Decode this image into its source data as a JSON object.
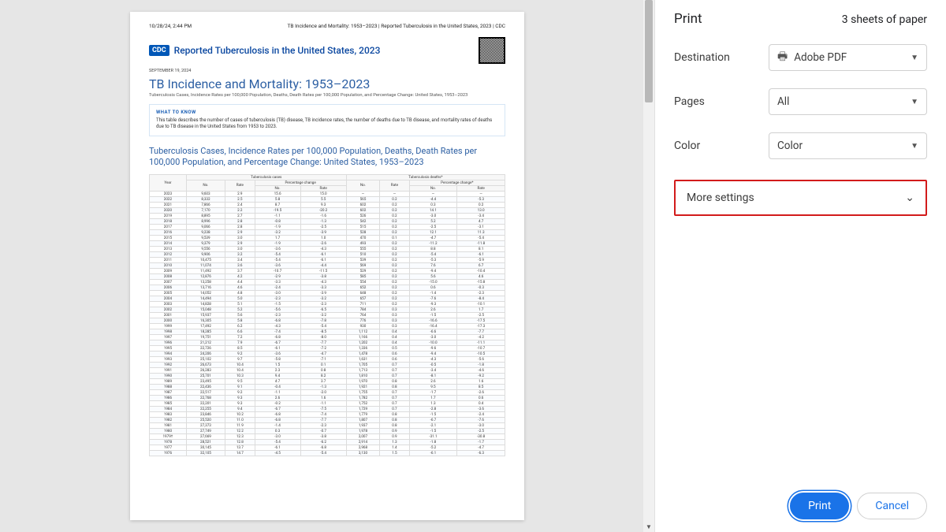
{
  "panel": {
    "title": "Print",
    "sheet_count": "3 sheets of paper",
    "destination_label": "Destination",
    "destination_value": "Adobe PDF",
    "pages_label": "Pages",
    "pages_value": "All",
    "color_label": "Color",
    "color_value": "Color",
    "more_label": "More settings",
    "print_btn": "Print",
    "cancel_btn": "Cancel"
  },
  "doc": {
    "timestamp": "10/28/24, 2:44 PM",
    "header_title": "TB Incidence and Mortality: 1953–2023 | Reported Tuberculosis in the United States, 2023 | CDC",
    "cdc_badge": "CDC",
    "brand_title": "Reported Tuberculosis in the United States, 2023",
    "pub_date": "SEPTEMBER 19, 2024",
    "title": "TB Incidence and Mortality: 1953–2023",
    "subtitle": "Tuberculosis Cases, Incidence Rates per 100,000 Population, Deaths, Death Rates per 100,000 Population, and Percentage Change: United States, 1953–2023",
    "what_label": "WHAT TO KNOW",
    "what_text": "This table describes the number of cases of tuberculosis (TB) disease, TB incidence rates, the number of deaths due to TB disease, and mortality rates of deaths due to TB disease in the United States from 1953 to 2023.",
    "section_title": "Tuberculosis Cases, Incidence Rates per 100,000 Population, Deaths, Death Rates per 100,000 Population, and Percentage Change: United States, 1953–2023",
    "th_group_cases": "Tuberculosis cases",
    "th_group_deaths": "Tuberculosis deaths*",
    "th_pct": "Percentage change",
    "th_pct2": "Percentage change*",
    "th_year": "Year",
    "th_no": "No.",
    "th_rate": "Rate"
  },
  "rows": [
    [
      "2023",
      "9,603",
      "2.9",
      "15.6",
      "15.0",
      "—",
      "—",
      "—",
      "—"
    ],
    [
      "2022",
      "8,332",
      "2.5",
      "5.8",
      "5.5",
      "565",
      "0.2",
      "-4.4",
      "-5.3"
    ],
    [
      "2021",
      "7,866",
      "2.4",
      "8.7",
      "9.3",
      "602",
      "0.2",
      "0.3",
      "0.2"
    ],
    [
      "2020",
      "7,170",
      "2.2",
      "-19.5",
      "-20.2",
      "602",
      "0.2",
      "14.1",
      "13.0"
    ],
    [
      "2019",
      "8,895",
      "2.7",
      "-1.1",
      "-1.6",
      "526",
      "0.2",
      "-3.0",
      "-3.4"
    ],
    [
      "2018",
      "8,996",
      "2.8",
      "-0.8",
      "-1.3",
      "542",
      "0.2",
      "5.2",
      "4.7"
    ],
    [
      "2017",
      "9,066",
      "2.8",
      "-1.9",
      "-2.5",
      "515",
      "0.2",
      "-2.5",
      "-3.1"
    ],
    [
      "2016",
      "9,238",
      "2.9",
      "-3.2",
      "-3.9",
      "528",
      "0.2",
      "12.1",
      "11.3"
    ],
    [
      "2015",
      "9,539",
      "3.0",
      "1.7",
      "1.0",
      "470",
      "0.1",
      "-4.7",
      "-5.4"
    ],
    [
      "2014",
      "9,379",
      "2.9",
      "-1.9",
      "-2.6",
      "493",
      "0.2",
      "-11.2",
      "-11.8"
    ],
    [
      "2013",
      "9,556",
      "3.0",
      "-3.6",
      "-4.3",
      "555",
      "0.2",
      "8.8",
      "8.1"
    ],
    [
      "2012",
      "9,906",
      "3.2",
      "-5.4",
      "-6.1",
      "510",
      "0.2",
      "-5.4",
      "-6.1"
    ],
    [
      "2011",
      "10,475",
      "3.4",
      "-5.4",
      "-6.1",
      "539",
      "0.2",
      "-5.3",
      "-5.9"
    ],
    [
      "2010",
      "11,074",
      "3.6",
      "-3.6",
      "-4.4",
      "569",
      "0.2",
      "7.6",
      "6.7"
    ],
    [
      "2009",
      "11,492",
      "3.7",
      "-10.7",
      "-11.5",
      "529",
      "0.2",
      "-9.4",
      "-10.4"
    ],
    [
      "2008",
      "12,876",
      "4.2",
      "-2.9",
      "-3.8",
      "585",
      "0.2",
      "5.6",
      "4.6"
    ],
    [
      "2007",
      "13,258",
      "4.4",
      "-3.3",
      "-4.3",
      "554",
      "0.2",
      "-15.0",
      "-15.8"
    ],
    [
      "2006",
      "13,716",
      "4.6",
      "-2.4",
      "-3.3",
      "652",
      "0.2",
      "0.6",
      "-0.3"
    ],
    [
      "2005",
      "14,052",
      "4.8",
      "-3.0",
      "-3.9",
      "648",
      "0.2",
      "-1.4",
      "-2.3"
    ],
    [
      "2004",
      "14,494",
      "5.0",
      "-2.3",
      "-3.2",
      "657",
      "0.2",
      "-7.6",
      "-8.4"
    ],
    [
      "2003",
      "14,828",
      "5.1",
      "-1.5",
      "-2.3",
      "711",
      "0.2",
      "-9.3",
      "-10.1"
    ],
    [
      "2002",
      "15,048",
      "5.2",
      "-5.6",
      "-6.5",
      "784",
      "0.3",
      "2.6",
      "1.7"
    ],
    [
      "2001",
      "15,937",
      "5.6",
      "-2.3",
      "-3.2",
      "764",
      "0.3",
      "-1.5",
      "-2.5"
    ],
    [
      "2000",
      "16,305",
      "5.8",
      "-6.8",
      "-7.8",
      "776",
      "0.3",
      "-16.6",
      "-17.5"
    ],
    [
      "1999",
      "17,492",
      "6.2",
      "-4.3",
      "-5.4",
      "930",
      "0.3",
      "-16.4",
      "-17.3"
    ],
    [
      "1998",
      "18,285",
      "6.6",
      "-7.4",
      "-8.5",
      "1,112",
      "0.4",
      "-6.6",
      "-7.7"
    ],
    [
      "1997",
      "19,751",
      "7.2",
      "-6.8",
      "-8.0",
      "1,166",
      "0.4",
      "-3.0",
      "-4.2"
    ],
    [
      "1996",
      "21,212",
      "7.9",
      "-6.7",
      "-7.7",
      "1,202",
      "0.4",
      "-10.0",
      "-11.1"
    ],
    [
      "1995",
      "22,726",
      "8.5",
      "-6.1",
      "-7.2",
      "1,336",
      "0.5",
      "-9.6",
      "-10.7"
    ],
    [
      "1994",
      "24,206",
      "9.2",
      "-3.6",
      "-4.7",
      "1,478",
      "0.6",
      "-9.4",
      "-10.5"
    ],
    [
      "1993",
      "25,102",
      "9.7",
      "-5.8",
      "-7.1",
      "1,631",
      "0.6",
      "-4.3",
      "-5.6"
    ],
    [
      "1992",
      "26,673",
      "10.4",
      "1.5",
      "0.1",
      "1,705",
      "0.7",
      "-0.5",
      "-1.8"
    ],
    [
      "1991",
      "26,283",
      "10.4",
      "2.3",
      "0.8",
      "1,713",
      "0.7",
      "-3.4",
      "-4.6"
    ],
    [
      "1990",
      "25,701",
      "10.3",
      "9.4",
      "8.2",
      "1,810",
      "0.7",
      "-8.1",
      "-9.2"
    ],
    [
      "1989",
      "23,495",
      "9.5",
      "4.7",
      "3.7",
      "1,970",
      "0.8",
      "2.6",
      "1.6"
    ],
    [
      "1988",
      "22,436",
      "9.1",
      "-0.4",
      "-1.3",
      "1,921",
      "0.8",
      "9.5",
      "8.5"
    ],
    [
      "1987",
      "22,517",
      "9.2",
      "-1.1",
      "-2.0",
      "1,755",
      "0.7",
      "-1.7",
      "-2.6"
    ],
    [
      "1986",
      "22,768",
      "9.3",
      "2.6",
      "1.6",
      "1,782",
      "0.7",
      "1.7",
      "0.6"
    ],
    [
      "1985",
      "22,201",
      "9.3",
      "-0.2",
      "-1.1",
      "1,752",
      "0.7",
      "1.3",
      "0.4"
    ],
    [
      "1984",
      "22,255",
      "9.4",
      "-6.7",
      "-7.5",
      "1,729",
      "0.7",
      "-2.8",
      "-3.6"
    ],
    [
      "1983",
      "23,846",
      "10.2",
      "-6.8",
      "-7.4",
      "1,779",
      "0.8",
      "-1.5",
      "-2.4"
    ],
    [
      "1982",
      "25,520",
      "11.0",
      "-6.8",
      "-7.7",
      "1,807",
      "0.8",
      "-6.7",
      "-7.6"
    ],
    [
      "1981",
      "27,373",
      "11.9",
      "-1.4",
      "-2.3",
      "1,937",
      "0.8",
      "-2.1",
      "-3.0"
    ],
    [
      "1980",
      "27,749",
      "12.2",
      "0.3",
      "-0.7",
      "1,978",
      "0.9",
      "-1.5",
      "-2.5"
    ],
    [
      "1979†",
      "27,669",
      "12.3",
      "-3.0",
      "-3.8",
      "2,007",
      "0.9",
      "-31.1",
      "-30.8"
    ],
    [
      "1978",
      "28,521",
      "12.8",
      "-5.4",
      "-6.2",
      "2,914",
      "1.3",
      "-1.8",
      "-1.7"
    ],
    [
      "1977",
      "30,145",
      "13.7",
      "-6.1",
      "-6.8",
      "2,968",
      "1.4",
      "-5.2",
      "-4.7"
    ],
    [
      "1976",
      "32,105",
      "14.7",
      "-4.5",
      "-5.4",
      "3,130",
      "1.5",
      "-6.1",
      "-6.3"
    ]
  ]
}
